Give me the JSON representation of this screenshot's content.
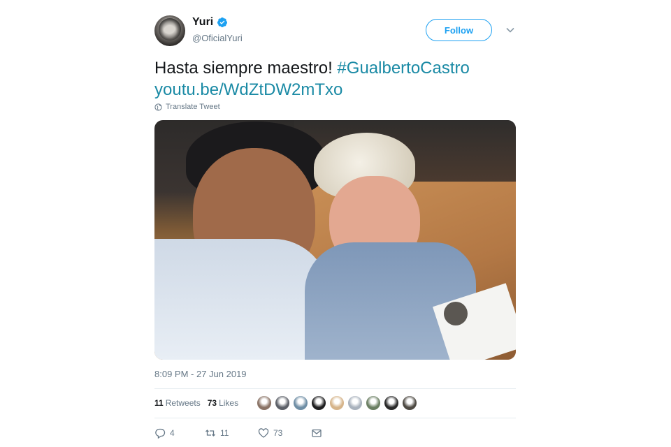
{
  "user": {
    "display_name": "Yuri",
    "handle": "@OficialYuri",
    "verified": true,
    "verified_color": "#1da1f2"
  },
  "header": {
    "follow_label": "Follow",
    "caret_icon": "chevron-down-icon"
  },
  "tweet": {
    "text": "Hasta siempre maestro! ",
    "hashtag": "#GualbertoCastro",
    "link": "youtu.be/WdZtDW2mTxo",
    "link_color": "#1a8aa5",
    "translate_label": "Translate Tweet"
  },
  "media": {
    "type": "photo"
  },
  "meta": {
    "timestamp": "8:09 PM - 27 Jun 2019"
  },
  "stats": {
    "retweets_count": "11",
    "retweets_label": "Retweets",
    "likes_count": "73",
    "likes_label": "Likes",
    "liker_colors": [
      "#8a7366",
      "#5c6068",
      "#6f8ea5",
      "#1f1f20",
      "#d6b48a",
      "#a9b2bd",
      "#6b7f63",
      "#2a2a2a",
      "#4e4a43"
    ]
  },
  "actions": {
    "reply_count": "4",
    "retweet_count": "11",
    "like_count": "73"
  },
  "colors": {
    "text_primary": "#14171a",
    "text_secondary": "#657786",
    "accent": "#1da1f2",
    "divider": "#e6ecf0"
  }
}
